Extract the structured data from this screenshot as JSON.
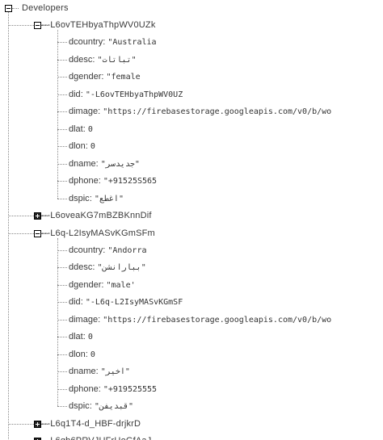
{
  "root": {
    "label": "Developers"
  },
  "separator": "--",
  "nodes": [
    {
      "id": "-L6ovTEHbyaThpWV0UZk",
      "expanded": true,
      "fields": [
        {
          "key": "dcountry",
          "value": "\"Australia"
        },
        {
          "key": "ddesc",
          "value": "\"تباتات\""
        },
        {
          "key": "dgender",
          "value": "\"female"
        },
        {
          "key": "did",
          "value": "\"-L6ovTEHbyaThpWV0UZ"
        },
        {
          "key": "dimage",
          "value": "\"https://firebasestorage.googleapis.com/v0/b/wo"
        },
        {
          "key": "dlat",
          "value": "0"
        },
        {
          "key": "dlon",
          "value": "0"
        },
        {
          "key": "dname",
          "value": "\"جديدسر\""
        },
        {
          "key": "dphone",
          "value": "\"+91525S565"
        },
        {
          "key": "dspic",
          "value": "\"اغطع\""
        }
      ]
    },
    {
      "id": "-L6oveaKG7mBZBKnnDif",
      "expanded": false,
      "fields": []
    },
    {
      "id": "-L6q-L2IsyMASvKGmSFm",
      "expanded": true,
      "fields": [
        {
          "key": "dcountry",
          "value": "\"Andorra"
        },
        {
          "key": "ddesc",
          "value": "\"ببارانشن\""
        },
        {
          "key": "dgender",
          "value": "\"male'"
        },
        {
          "key": "did",
          "value": "\"-L6q-L2IsyMASvKGmSF"
        },
        {
          "key": "dimage",
          "value": "\"https://firebasestorage.googleapis.com/v0/b/wo"
        },
        {
          "key": "dlat",
          "value": "0"
        },
        {
          "key": "dlon",
          "value": "0"
        },
        {
          "key": "dname",
          "value": "\"اخير\""
        },
        {
          "key": "dphone",
          "value": "\"+919525555"
        },
        {
          "key": "dspic",
          "value": "\"قبديفن\""
        }
      ]
    },
    {
      "id": "-L6q1T4-d_HBF-drjkrD",
      "expanded": false,
      "fields": []
    },
    {
      "id": "-L6qb6PRVJUFrUoGfAaJ",
      "expanded": false,
      "fields": []
    }
  ]
}
